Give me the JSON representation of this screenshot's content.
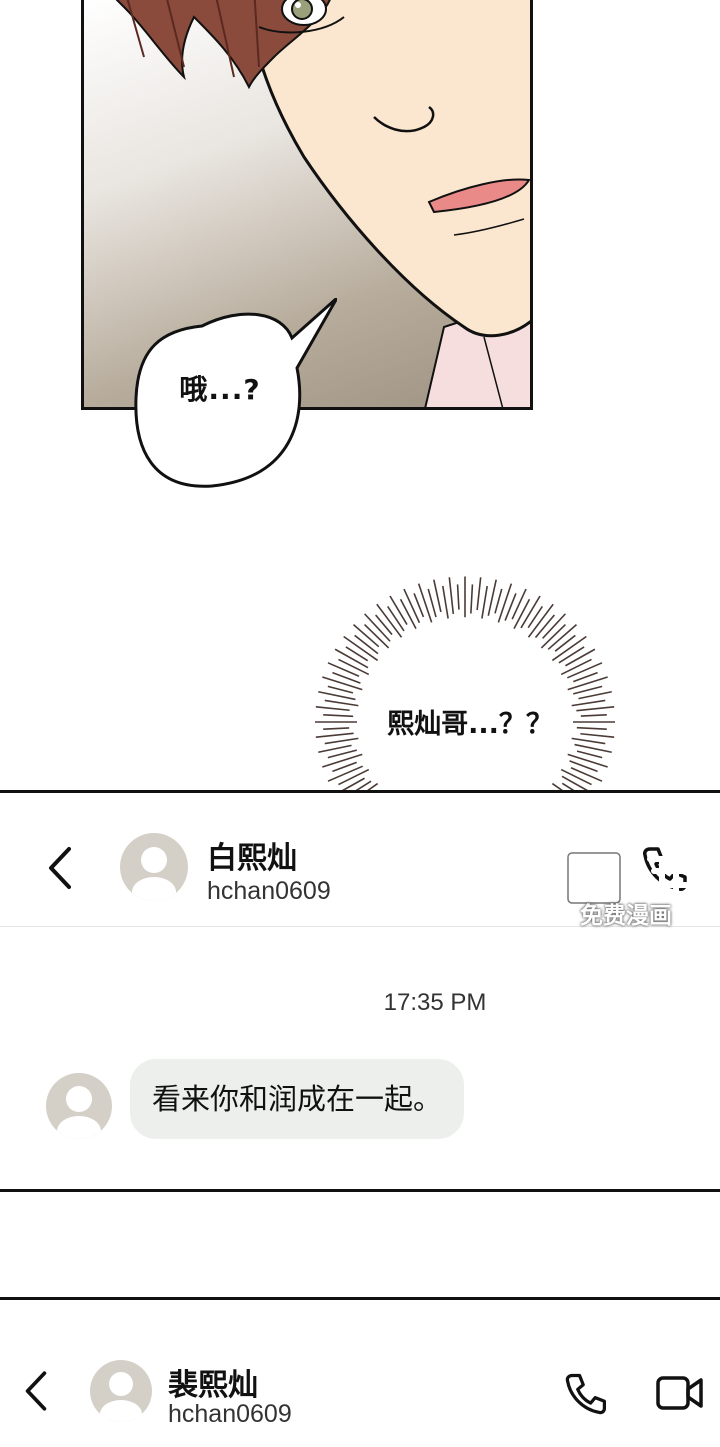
{
  "panel1": {
    "speech": "哦...?"
  },
  "burst": {
    "text": "熙灿哥...？？"
  },
  "chat1": {
    "back_icon": "chevron-left-icon",
    "contact_name": "白熙灿",
    "contact_handle": "hchan0609",
    "call_icon": "phone-icon",
    "time": "17:35 PM",
    "message": "看来你和润成在一起。"
  },
  "watermark": {
    "text": "免费漫画"
  },
  "chat2": {
    "back_icon": "chevron-left-icon",
    "contact_name": "裴熙灿",
    "contact_handle": "hchan0609",
    "call_icon": "phone-icon",
    "video_icon": "video-camera-icon"
  },
  "colors": {
    "message_bubble": "#ecefec",
    "avatar_bg": "#d4d0c8",
    "hair": "#8a4a3c",
    "skin": "#fbe7cf",
    "lips": "#e98a88"
  }
}
